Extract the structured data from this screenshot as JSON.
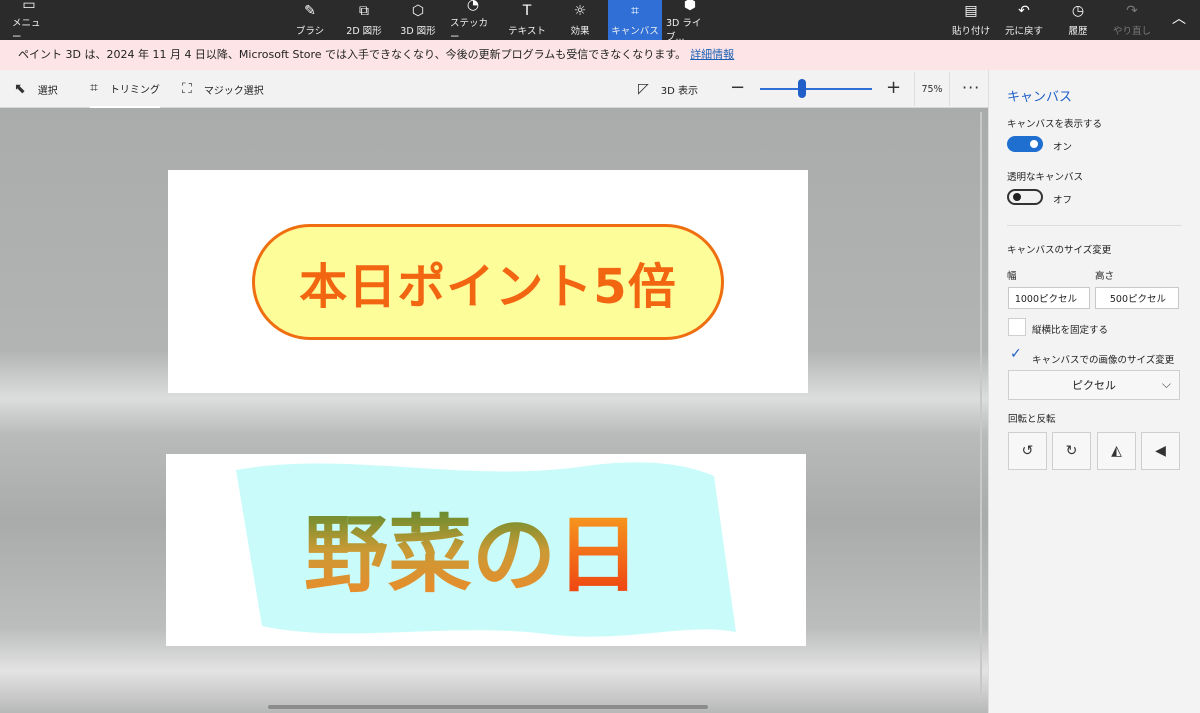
{
  "toolbar": {
    "menu": "メニュー",
    "brush": "ブラシ",
    "shapes2d": "2D 図形",
    "shapes3d": "3D 図形",
    "sticker": "ステッカー",
    "text": "テキスト",
    "effects": "効果",
    "canvas": "キャンバス",
    "library3d": "3D ライブ...",
    "paste": "貼り付け",
    "undo": "元に戻す",
    "history": "履歴",
    "redo": "やり直し"
  },
  "notice": {
    "message": "ペイント 3D は、2024 年 11 月 4 日以降、Microsoft Store では入手できなくなり、今後の更新プログラムも受信できなくなります。",
    "link": "詳細情報"
  },
  "subtools": {
    "select": "選択",
    "crop": "トリミング",
    "magic_select": "マジック選択",
    "view3d": "3D 表示",
    "zoom_label": "75%",
    "zoom_value": 0.38
  },
  "canvas": {
    "banner1_text": "本日ポイント5倍",
    "banner2_text": "野菜の日"
  },
  "panel": {
    "title": "キャンバス",
    "show_canvas_label": "キャンバスを表示する",
    "show_canvas_state": "オン",
    "transparent_label": "透明なキャンバス",
    "transparent_state": "オフ",
    "resize_label": "キャンバスのサイズ変更",
    "width_label": "幅",
    "height_label": "高さ",
    "width_value": "1000ピクセル",
    "height_value": "500ピクセル",
    "lock_ratio_label": "縦横比を固定する",
    "resize_image_label": "キャンバスでの画像のサイズ変更",
    "unit_select": "ピクセル",
    "rotate_flip_label": "回転と反転"
  },
  "colors": {
    "accent": "#1f6fd1",
    "active_tool": "#2f6fd6",
    "pill_fill": "#fdfd9a",
    "pill_border": "#ef6e10",
    "banner2_bg": "#c9fbfb"
  }
}
